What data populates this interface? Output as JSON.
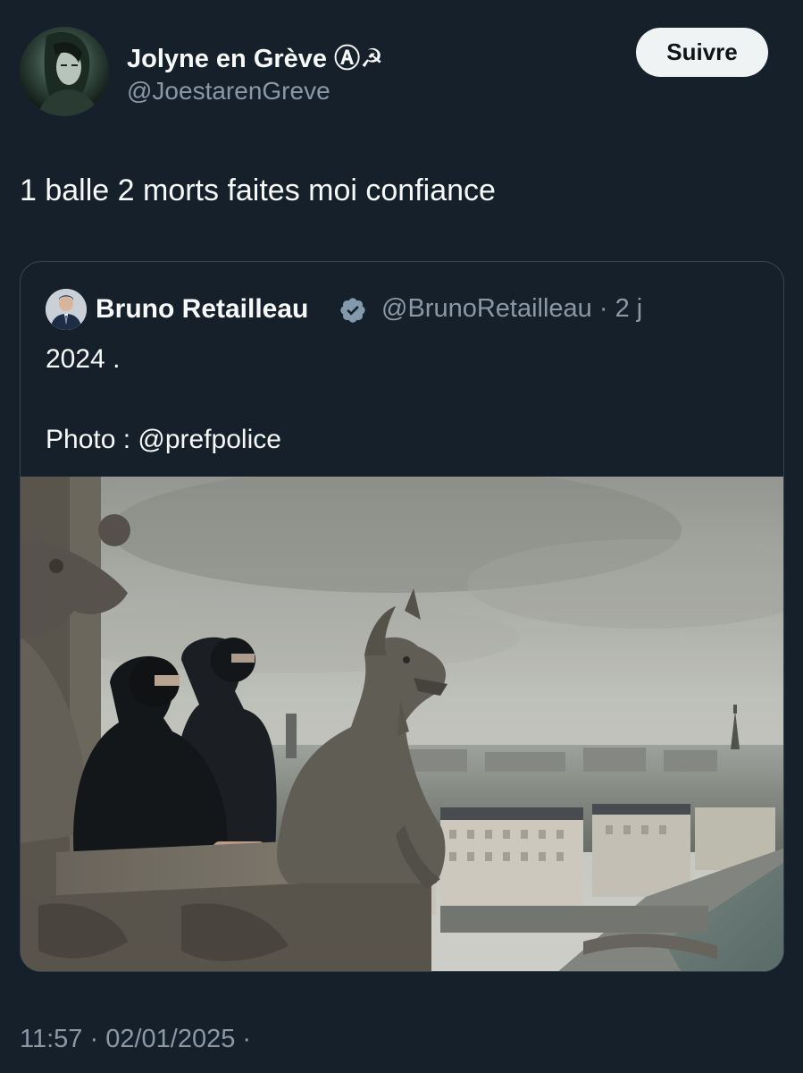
{
  "author": {
    "display_name": "Jolyne en Grève Ⓐ☭",
    "handle": "@JoestarenGreve",
    "follow_label": "Suivre"
  },
  "tweet": {
    "text": "1 balle 2 morts faites moi confiance",
    "timestamp": "11:57 · 02/01/2025 ·"
  },
  "quoted_tweet": {
    "author_name": "Bruno Retailleau",
    "handle_time": "@BrunoRetailleau · 2 j",
    "line1": "2024 .",
    "line2": "Photo : @prefpolice"
  },
  "colors": {
    "background": "#15202b",
    "text_primary": "#f7f9f9",
    "text_secondary": "#8b98a5",
    "border": "#38444d",
    "follow_button_bg": "#eff3f4",
    "verified_badge": "#829aab"
  },
  "icons": {
    "verified": "verified-badge-icon"
  }
}
